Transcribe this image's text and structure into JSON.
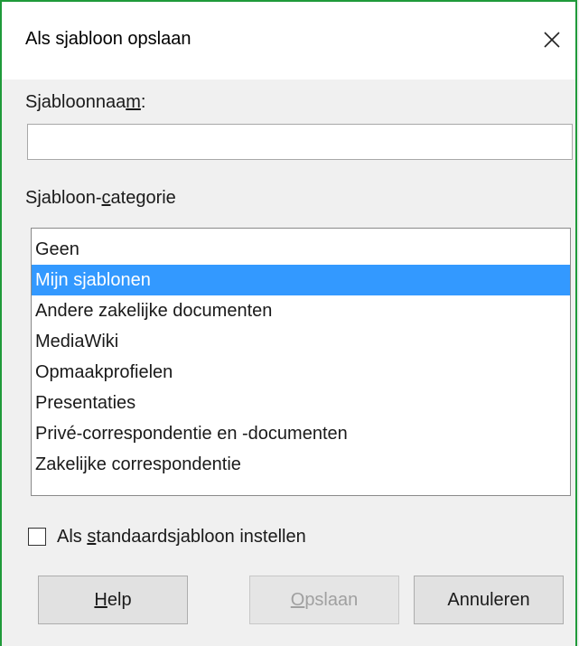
{
  "dialog": {
    "title": "Als sjabloon opslaan",
    "close_icon": "close-icon"
  },
  "name_field": {
    "label_pre": "Sjabloonnaa",
    "label_u": "m",
    "label_post": ":",
    "value": ""
  },
  "category": {
    "label_pre": "Sjabloon-",
    "label_u": "c",
    "label_post": "ategorie",
    "items": [
      "Geen",
      "Mijn sjablonen",
      "Andere zakelijke documenten",
      "MediaWiki",
      "Opmaakprofielen",
      "Presentaties",
      "Privé-correspondentie en -documenten",
      "Zakelijke correspondentie"
    ],
    "selected": "Mijn sjablonen"
  },
  "default_checkbox": {
    "label_pre": "Als ",
    "label_u": "s",
    "label_post": "tandaardsjabloon instellen",
    "checked": false
  },
  "buttons": {
    "help_u": "H",
    "help_rest": "elp",
    "save_u": "O",
    "save_rest": "pslaan",
    "cancel": "Annuleren"
  },
  "colors": {
    "selection": "#3399ff",
    "window_border": "#1f9a3a"
  }
}
